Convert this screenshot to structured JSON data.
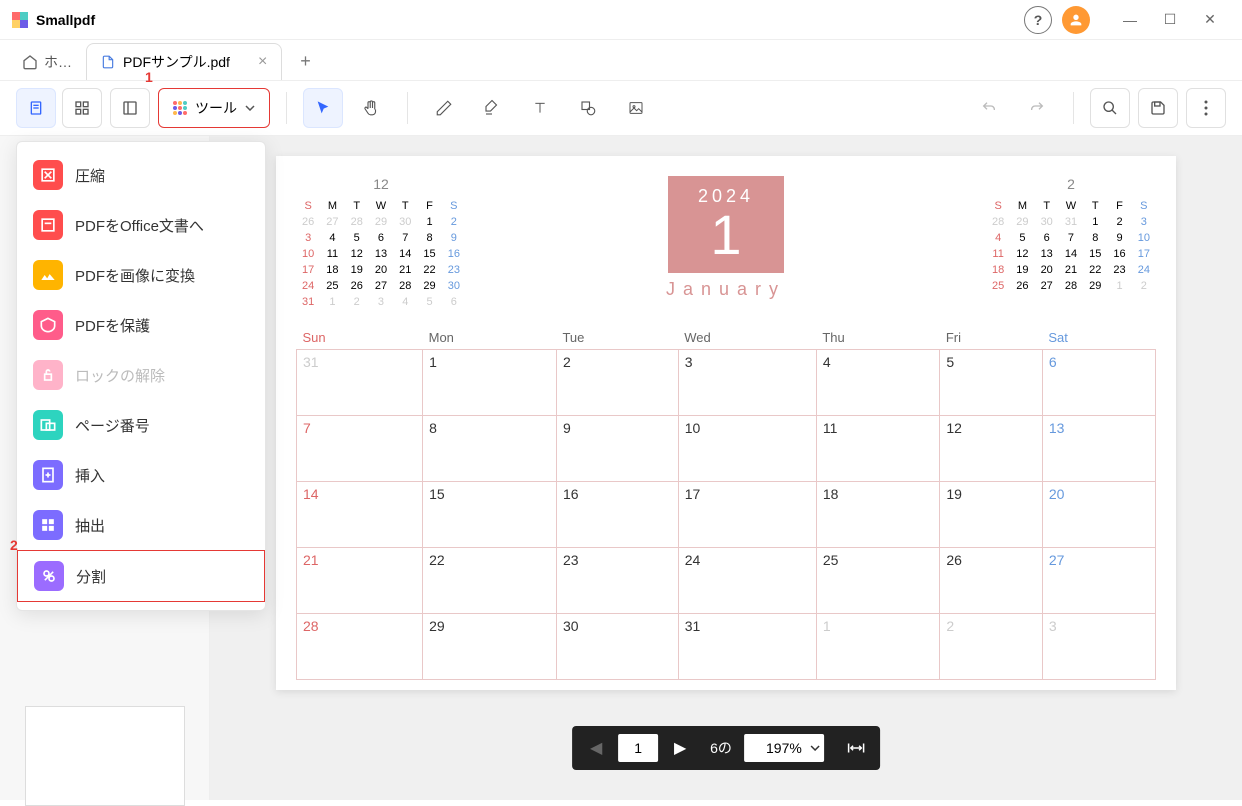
{
  "app": {
    "name": "Smallpdf"
  },
  "window_controls": {
    "minimize": "—",
    "maximize": "☐",
    "close": "✕"
  },
  "tabs": {
    "home_label": "ホ…",
    "doc_label": "PDFサンプル.pdf",
    "new_tab": "+"
  },
  "toolbar": {
    "tools_label": "ツール",
    "callout1": "1"
  },
  "dropdown": {
    "callout2": "2",
    "items": [
      {
        "label": "圧縮"
      },
      {
        "label": "PDFをOffice文書へ"
      },
      {
        "label": "PDFを画像に変換"
      },
      {
        "label": "PDFを保護"
      },
      {
        "label": "ロックの解除",
        "disabled": true
      },
      {
        "label": "ページ番号"
      },
      {
        "label": "挿入"
      },
      {
        "label": "抽出"
      },
      {
        "label": "分割",
        "highlighted": true
      }
    ]
  },
  "calendar": {
    "year": "2024",
    "month_num": "1",
    "month_name": "January",
    "mini_prev": {
      "title": "12",
      "dow": [
        "S",
        "M",
        "T",
        "W",
        "T",
        "F",
        "S"
      ],
      "rows": [
        [
          "26",
          "27",
          "28",
          "29",
          "30",
          "1",
          "2"
        ],
        [
          "3",
          "4",
          "5",
          "6",
          "7",
          "8",
          "9"
        ],
        [
          "10",
          "11",
          "12",
          "13",
          "14",
          "15",
          "16"
        ],
        [
          "17",
          "18",
          "19",
          "20",
          "21",
          "22",
          "23"
        ],
        [
          "24",
          "25",
          "26",
          "27",
          "28",
          "29",
          "30"
        ],
        [
          "31",
          "1",
          "2",
          "3",
          "4",
          "5",
          "6"
        ]
      ]
    },
    "mini_next": {
      "title": "2",
      "dow": [
        "S",
        "M",
        "T",
        "W",
        "T",
        "F",
        "S"
      ],
      "rows": [
        [
          "28",
          "29",
          "30",
          "31",
          "1",
          "2",
          "3"
        ],
        [
          "4",
          "5",
          "6",
          "7",
          "8",
          "9",
          "10"
        ],
        [
          "11",
          "12",
          "13",
          "14",
          "15",
          "16",
          "17"
        ],
        [
          "18",
          "19",
          "20",
          "21",
          "22",
          "23",
          "24"
        ],
        [
          "25",
          "26",
          "27",
          "28",
          "29",
          "1",
          "2"
        ]
      ]
    },
    "big": {
      "dow": [
        "Sun",
        "Mon",
        "Tue",
        "Wed",
        "Thu",
        "Fri",
        "Sat"
      ],
      "rows": [
        [
          {
            "n": "31",
            "muted": true
          },
          {
            "n": "1"
          },
          {
            "n": "2"
          },
          {
            "n": "3"
          },
          {
            "n": "4"
          },
          {
            "n": "5"
          },
          {
            "n": "6"
          }
        ],
        [
          {
            "n": "7"
          },
          {
            "n": "8"
          },
          {
            "n": "9"
          },
          {
            "n": "10"
          },
          {
            "n": "11"
          },
          {
            "n": "12"
          },
          {
            "n": "13"
          }
        ],
        [
          {
            "n": "14"
          },
          {
            "n": "15"
          },
          {
            "n": "16"
          },
          {
            "n": "17"
          },
          {
            "n": "18"
          },
          {
            "n": "19"
          },
          {
            "n": "20"
          }
        ],
        [
          {
            "n": "21"
          },
          {
            "n": "22"
          },
          {
            "n": "23"
          },
          {
            "n": "24"
          },
          {
            "n": "25"
          },
          {
            "n": "26"
          },
          {
            "n": "27"
          }
        ],
        [
          {
            "n": "28"
          },
          {
            "n": "29"
          },
          {
            "n": "30"
          },
          {
            "n": "31"
          },
          {
            "n": "1",
            "muted": true
          },
          {
            "n": "2",
            "muted": true
          },
          {
            "n": "3",
            "muted": true
          }
        ]
      ]
    }
  },
  "nav": {
    "page_current": "1",
    "page_total": "6の",
    "zoom": "197%"
  }
}
